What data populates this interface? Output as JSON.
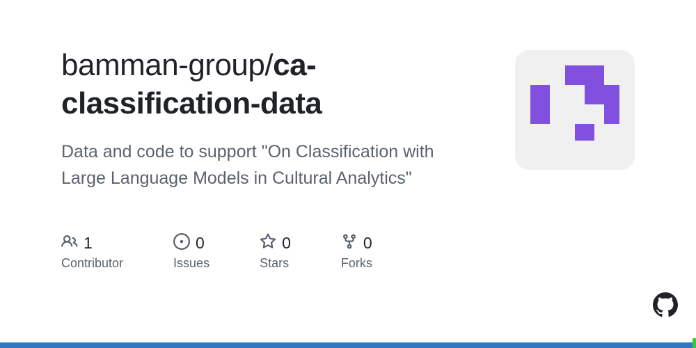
{
  "repo": {
    "owner": "bamman-group",
    "slash": "/",
    "name": "ca-classification-data",
    "description": "Data and code to support \"On Classification with Large Language Models in Cultural Analytics\""
  },
  "stats": {
    "contributors": {
      "count": "1",
      "label": "Contributor"
    },
    "issues": {
      "count": "0",
      "label": "Issues"
    },
    "stars": {
      "count": "0",
      "label": "Stars"
    },
    "forks": {
      "count": "0",
      "label": "Forks"
    }
  },
  "colors": {
    "accent": "#8250df",
    "bar": "#3078c0"
  }
}
